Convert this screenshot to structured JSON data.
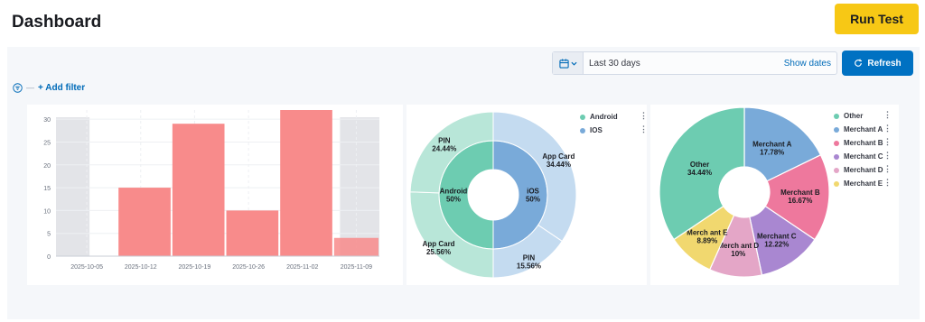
{
  "page": {
    "title": "Dashboard",
    "run_button": "Run Test"
  },
  "toolbar": {
    "date_range": "Last 30 days",
    "show_dates": "Show dates",
    "refresh": "Refresh",
    "add_filter": "+ Add filter",
    "icons": {
      "calendar": "calendar-icon",
      "chevron": "chevron-down-icon",
      "refresh": "refresh-icon",
      "filter": "filter-icon"
    }
  },
  "chart_data": [
    {
      "type": "bar",
      "ylim": [
        0,
        32
      ],
      "yticks": [
        0,
        5,
        10,
        15,
        20,
        25,
        30
      ],
      "xticks": [
        "2025-10-05",
        "2025-10-12",
        "2025-10-19",
        "2025-10-26",
        "2025-11-02",
        "2025-11-09"
      ],
      "shaded_ranges": [
        [
          "2025-10-01",
          "2025-10-05"
        ],
        "partial-week-end"
      ],
      "bars": [
        {
          "week_start": "2025-10-09",
          "value": 15
        },
        {
          "week_start": "2025-10-16",
          "value": 29
        },
        {
          "week_start": "2025-10-23",
          "value": 10
        },
        {
          "week_start": "2025-10-30",
          "value": 32
        },
        {
          "week_start": "2025-11-06",
          "value": 4
        }
      ],
      "color": "#f88b8b",
      "grid": true
    },
    {
      "type": "pie",
      "legend": [
        {
          "label": "Android",
          "color": "#6dccb1"
        },
        {
          "label": "IOS",
          "color": "#79aad9"
        }
      ],
      "inner_ring": [
        {
          "label": "Android",
          "percent": "50%",
          "value": 50,
          "color": "#6dccb1"
        },
        {
          "label": "iOS",
          "percent": "50%",
          "value": 50,
          "color": "#79aad9"
        }
      ],
      "outer_ring": [
        {
          "label": "App Card",
          "percent": "34.44%",
          "value": 34.44,
          "color": "#c4dbf0"
        },
        {
          "label": "PIN",
          "percent": "15.56%",
          "value": 15.56,
          "color": "#c4dbf0"
        },
        {
          "label": "App Card",
          "percent": "25.56%",
          "value": 25.56,
          "color": "#b8e6d8"
        },
        {
          "label": "PIN",
          "percent": "24.44%",
          "value": 24.44,
          "color": "#b8e6d8"
        }
      ]
    },
    {
      "type": "pie",
      "legend": [
        {
          "label": "Other",
          "color": "#6dccb1"
        },
        {
          "label": "Merchant A",
          "color": "#79aad9"
        },
        {
          "label": "Merchant B",
          "color": "#ee789d"
        },
        {
          "label": "Merchant C",
          "color": "#a987d1"
        },
        {
          "label": "Merchant D",
          "color": "#e4a6c7"
        },
        {
          "label": "Merchant E",
          "color": "#f1d86f"
        }
      ],
      "slices": [
        {
          "label": "Merchant A",
          "percent": "17.78%",
          "value": 17.78,
          "color": "#79aad9"
        },
        {
          "label": "Merchant B",
          "percent": "16.67%",
          "value": 16.67,
          "color": "#ee789d"
        },
        {
          "label": "Merchant C",
          "percent": "12.22%",
          "value": 12.22,
          "color": "#a987d1"
        },
        {
          "label": "Merch ant D",
          "percent": "10%",
          "value": 10,
          "color": "#e4a6c7"
        },
        {
          "label": "Merch ant E",
          "percent": "8.89%",
          "value": 8.89,
          "color": "#f1d86f"
        },
        {
          "label": "Other",
          "percent": "34.44%",
          "value": 34.44,
          "color": "#6dccb1"
        }
      ]
    }
  ]
}
